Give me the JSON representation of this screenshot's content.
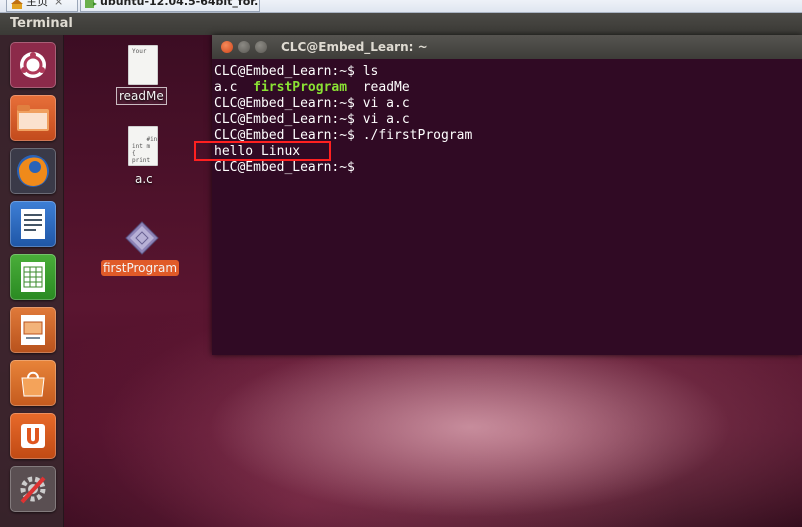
{
  "vmware_tabs": [
    {
      "label": "主页",
      "icon": "home-icon"
    },
    {
      "label": "ubuntu-12.04.5-64bit_for...",
      "icon": "vm-icon"
    }
  ],
  "tab_close_glyph": "×",
  "topbar": {
    "title": "Terminal"
  },
  "launcher": [
    "dash-home-icon",
    "files-folder-icon",
    "firefox-icon",
    "writer-icon",
    "calc-icon",
    "impress-icon",
    "software-center-icon",
    "ubuntu-one-icon",
    "system-settings-icon"
  ],
  "desktop_icons": {
    "readme": {
      "label": "readMe",
      "preview": "Your"
    },
    "ac": {
      "label": "a.c",
      "preview": "#incl\nint m\n{\nprint"
    },
    "firstprogram": {
      "label": "firstProgram"
    }
  },
  "terminal": {
    "title": "CLC@Embed_Learn: ~",
    "lines": [
      "CLC@Embed_Learn:~$ ls",
      "a.c  firstProgram  readMe",
      "CLC@Embed_Learn:~$ vi a.c",
      "CLC@Embed_Learn:~$ vi a.c",
      "CLC@Embed_Learn:~$ ./firstProgram",
      "hello Linux",
      "CLC@Embed_Learn:~$ "
    ],
    "ls_output": {
      "a": "a.c  ",
      "b": "firstProgram",
      "c": "  readMe"
    },
    "highlighted_line": "hello Linux",
    "colors": {
      "background": "#300a24",
      "text": "#ffffff",
      "executable": "#8ae234",
      "highlight_box": "#ff2020"
    }
  }
}
